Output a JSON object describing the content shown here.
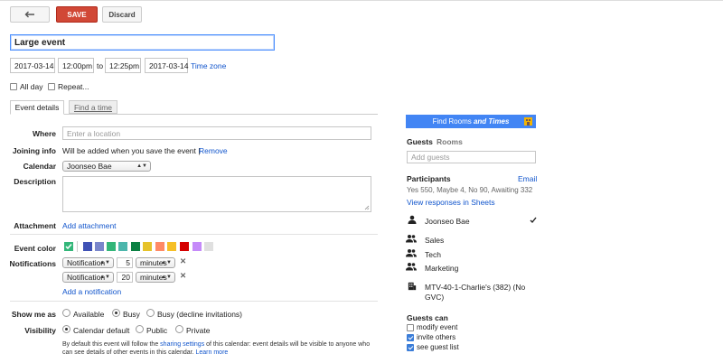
{
  "toolbar": {
    "back_icon": "arrow-left-icon",
    "save": "SAVE",
    "discard": "Discard"
  },
  "title": "Large event",
  "start_date": "2017-03-14",
  "start_time": "12:00pm",
  "to": "to",
  "end_time": "12:25pm",
  "end_date": "2017-03-14",
  "timezone": "Time zone",
  "allday": "All day",
  "repeat": "Repeat...",
  "tabs": {
    "details": "Event details",
    "find": "Find a time"
  },
  "where": {
    "label": "Where",
    "placeholder": "Enter a location"
  },
  "joining": {
    "label": "Joining info",
    "text": "Will be added when you save the event |",
    "remove": "Remove"
  },
  "calendar": {
    "label": "Calendar",
    "value": "Joonseo Bae"
  },
  "description": {
    "label": "Description"
  },
  "attachment": {
    "label": "Attachment",
    "link": "Add attachment"
  },
  "color": {
    "label": "Event color",
    "swatches": [
      "#3f51b5",
      "#7986cb",
      "#33b679",
      "#4cb6ac",
      "#0b8043",
      "#e6c229",
      "#ff8a65",
      "#f6bf26",
      "#d50000",
      "#c58af9",
      "#e0e0e0"
    ],
    "selected": "#33b679"
  },
  "notifications": {
    "label": "Notifications",
    "items": [
      {
        "type": "Notification",
        "value": "5",
        "unit": "minutes"
      },
      {
        "type": "Notification",
        "value": "20",
        "unit": "minutes"
      }
    ],
    "add": "Add a notification"
  },
  "showme": {
    "label": "Show me as",
    "available": "Available",
    "busy": "Busy",
    "busy_decline": "Busy (decline invitations)"
  },
  "visibility": {
    "label": "Visibility",
    "default": "Calendar default",
    "public": "Public",
    "private": "Private"
  },
  "note": {
    "pre": "By default this event will follow the ",
    "link": "sharing settings",
    "mid": " of this calendar: event details will be visible to anyone who",
    "line2": "can see details of other events in this calendar.",
    "more": "Learn more"
  },
  "findrooms": {
    "pre": "Find Rooms ",
    "em": "and Times"
  },
  "right_tabs": {
    "guests": "Guests",
    "rooms": "Rooms"
  },
  "add_guests": "Add guests",
  "participants": {
    "label": "Participants",
    "email": "Email",
    "stats": "Yes 550, Maybe 4, No 90, Awaiting 332",
    "view": "View responses in Sheets"
  },
  "guests": [
    {
      "name": "Joonseo Bae",
      "icon": "person-icon"
    },
    {
      "name": "Sales",
      "icon": "group-icon"
    },
    {
      "name": "Tech",
      "icon": "group-icon"
    },
    {
      "name": "Marketing",
      "icon": "group-icon"
    }
  ],
  "room": {
    "line1": "MTV-40-1-Charlie's (382) (No",
    "line2": "GVC)"
  },
  "guestscan": {
    "label": "Guests can",
    "modify": "modify event",
    "invite": "invite others",
    "see": "see guest list"
  }
}
